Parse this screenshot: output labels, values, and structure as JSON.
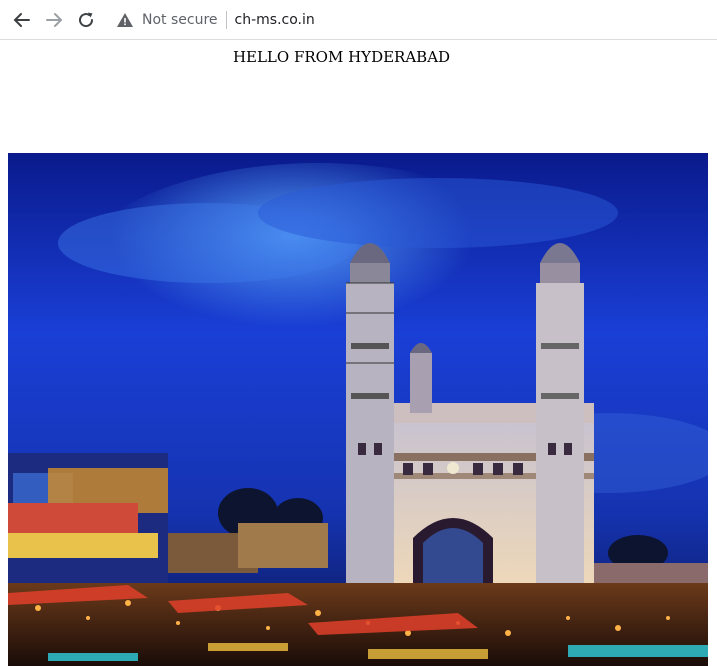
{
  "browser": {
    "security_label": "Not secure",
    "url": "ch-ms.co.in",
    "icons": {
      "back": "arrow-left-icon",
      "forward": "arrow-right-icon",
      "reload": "reload-icon",
      "security": "warning-triangle-icon"
    }
  },
  "page": {
    "heading": "HELLO FROM HYDERABAD",
    "image": {
      "subject": "Charminar monument lit at dusk with crowded night market"
    }
  },
  "colors": {
    "sky": "#1a3fd6",
    "monument": "#e8dccb",
    "lights": "#ffb347"
  }
}
